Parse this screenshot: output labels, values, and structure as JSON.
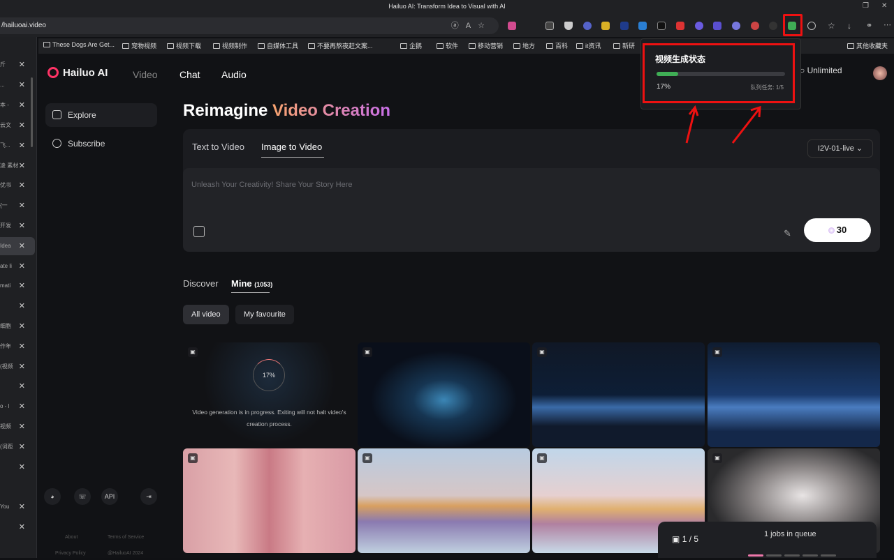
{
  "window": {
    "title": "Hailuo AI: Transform Idea to Visual with AI"
  },
  "address_bar": {
    "url": "/hailuoai.video"
  },
  "bookmarks": [
    "These Dogs Are Get...",
    "宠物视频",
    "视频下载",
    "视频制作",
    "自媒体工具",
    "不要再熬夜赶文案...",
    "企鹅",
    "软件",
    "移动营销",
    "地方",
    "百科",
    "it资讯",
    "新研",
    "其他收藏夹"
  ],
  "vertical_tabs": [
    "斤",
    "...",
    "本 -",
    "云文",
    "飞...",
    "凌 素材",
    "优书",
    "{一",
    "开发",
    "Idea",
    "ate li",
    "mati",
    "",
    "细胞",
    "作年",
    "(视频",
    "",
    "o - l",
    "视频",
    "(词距",
    "",
    "You",
    ""
  ],
  "app": {
    "logo": "Hailuo AI",
    "nav": {
      "video": "Video",
      "chat": "Chat",
      "audio": "Audio"
    },
    "sidebar": {
      "explore": "Explore",
      "subscribe": "Subscribe",
      "api": "API"
    },
    "footer": {
      "about": "About",
      "terms": "Terms of Service",
      "privacy": "Privacy Policy",
      "copyright": "@HailuoAI 2024"
    },
    "plan": "Unlimited",
    "hero": {
      "white": "Reimagine ",
      "gradient": "Video Creation"
    },
    "create_panel": {
      "tab_text": "Text to Video",
      "tab_image": "Image to Video",
      "model": "I2V-01-live",
      "placeholder": "Unleash Your Creativity! Share Your Story Here",
      "credits": "30"
    },
    "library": {
      "tab_discover": "Discover",
      "tab_mine": "Mine",
      "mine_count": "(1053)",
      "filter_all": "All video",
      "filter_fav": "My favourite",
      "in_progress": {
        "percent": "17%",
        "message": "Video generation is in progress. Exiting will not halt video's creation process."
      }
    },
    "queue": {
      "count": "1 / 5",
      "label": "1 jobs in queue",
      "active_bars": 1,
      "total_bars": 5
    }
  },
  "extension_popup": {
    "title": "视频生成状态",
    "progress": 0.17,
    "percent": "17%",
    "queue": "队列任务: 1/5"
  },
  "colors": {
    "highlight": "#ee1111",
    "progress_green": "#3fae55",
    "accent_pink": "#ff3366"
  }
}
